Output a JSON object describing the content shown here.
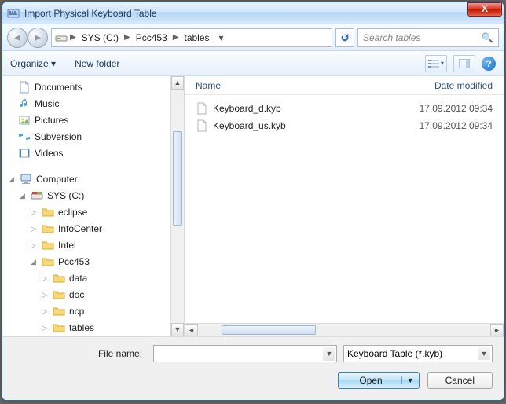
{
  "window_title": "Import Physical Keyboard Table",
  "breadcrumb": {
    "segments": [
      "SYS (C:)",
      "Pcc453",
      "tables"
    ]
  },
  "search": {
    "placeholder": "Search tables"
  },
  "toolbar": {
    "organize": "Organize",
    "new_folder": "New folder"
  },
  "tree": {
    "libraries": [
      {
        "label": "Documents"
      },
      {
        "label": "Music"
      },
      {
        "label": "Pictures"
      },
      {
        "label": "Subversion"
      },
      {
        "label": "Videos"
      }
    ],
    "computer_label": "Computer",
    "drive_label": "SYS (C:)",
    "folders": [
      {
        "label": "eclipse"
      },
      {
        "label": "InfoCenter"
      },
      {
        "label": "Intel"
      },
      {
        "label": "Pcc453",
        "expanded": true,
        "children": [
          {
            "label": "data"
          },
          {
            "label": "doc"
          },
          {
            "label": "ncp"
          },
          {
            "label": "tables"
          }
        ]
      }
    ]
  },
  "columns": {
    "name": "Name",
    "date": "Date modified"
  },
  "files": [
    {
      "name": "Keyboard_d.kyb",
      "date": "17.09.2012 09:34"
    },
    {
      "name": "Keyboard_us.kyb",
      "date": "17.09.2012 09:34"
    }
  ],
  "footer": {
    "filename_label": "File name:",
    "filename_value": "",
    "type_filter": "Keyboard Table (*.kyb)",
    "open": "Open",
    "cancel": "Cancel"
  }
}
